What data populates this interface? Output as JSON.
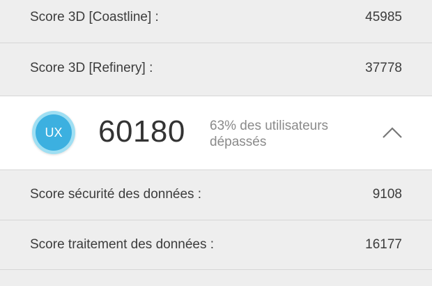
{
  "scores": [
    {
      "label": "Score 3D [Coastline] :",
      "value": "45985"
    },
    {
      "label": "Score 3D [Refinery] :",
      "value": "37778"
    }
  ],
  "ux": {
    "badge": "UX",
    "score": "60180",
    "percent_text": "63% des utilisateurs dépassés",
    "collapse_icon": "chevron-up-icon",
    "badge_color": "#3cb0e0",
    "badge_ring_color": "#9fdff3"
  },
  "ux_details": [
    {
      "label": "Score sécurité des données :",
      "value": "9108"
    },
    {
      "label": "Score traitement des données :",
      "value": "16177"
    }
  ]
}
